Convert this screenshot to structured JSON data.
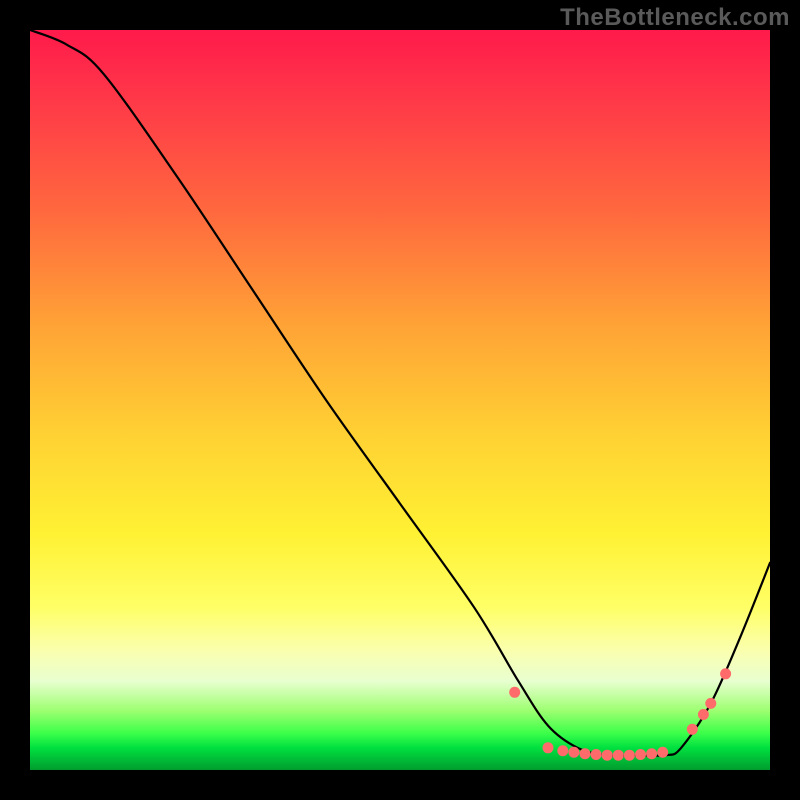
{
  "watermark": "TheBottleneck.com",
  "chart_data": {
    "type": "line",
    "title": "",
    "xlabel": "",
    "ylabel": "",
    "xlim": [
      0,
      100
    ],
    "ylim": [
      0,
      100
    ],
    "series": [
      {
        "name": "curve",
        "x": [
          0,
          5,
          10,
          20,
          30,
          40,
          50,
          60,
          66,
          70,
          74,
          78,
          82,
          86,
          88,
          92,
          96,
          100
        ],
        "y": [
          100,
          98,
          94,
          80,
          65,
          50,
          36,
          22,
          12,
          6,
          3,
          2,
          2,
          2,
          3,
          9,
          18,
          28
        ]
      }
    ],
    "dots": {
      "name": "markers",
      "color": "#ff6b6b",
      "points": [
        {
          "x": 65.5,
          "y": 10.5
        },
        {
          "x": 70.0,
          "y": 3.0
        },
        {
          "x": 72.0,
          "y": 2.6
        },
        {
          "x": 73.5,
          "y": 2.4
        },
        {
          "x": 75.0,
          "y": 2.2
        },
        {
          "x": 76.5,
          "y": 2.1
        },
        {
          "x": 78.0,
          "y": 2.0
        },
        {
          "x": 79.5,
          "y": 2.0
        },
        {
          "x": 81.0,
          "y": 2.0
        },
        {
          "x": 82.5,
          "y": 2.1
        },
        {
          "x": 84.0,
          "y": 2.2
        },
        {
          "x": 85.5,
          "y": 2.4
        },
        {
          "x": 89.5,
          "y": 5.5
        },
        {
          "x": 91.0,
          "y": 7.5
        },
        {
          "x": 92.0,
          "y": 9.0
        },
        {
          "x": 94.0,
          "y": 13.0
        }
      ]
    }
  }
}
